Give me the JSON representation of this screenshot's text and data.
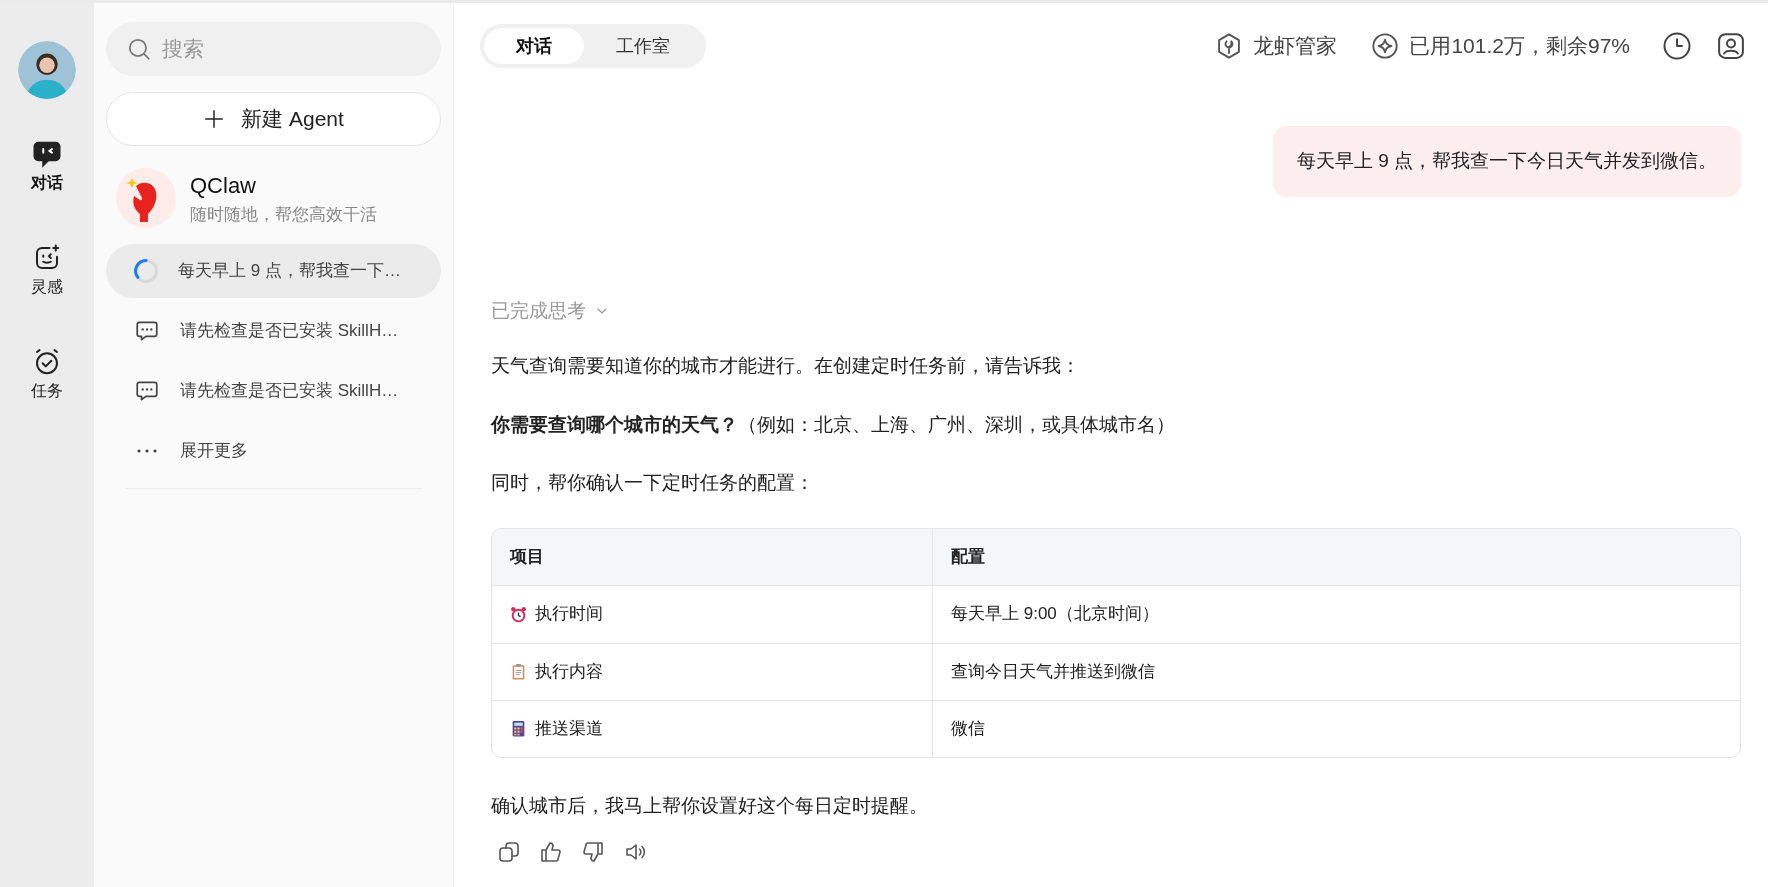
{
  "rail": {
    "nav": [
      {
        "label": "对话",
        "selected": true
      },
      {
        "label": "灵感",
        "selected": false
      },
      {
        "label": "任务",
        "selected": false
      }
    ]
  },
  "sidebar": {
    "search": {
      "placeholder": "搜索"
    },
    "new_button": "新建 Agent",
    "agent": {
      "name": "QClaw",
      "tagline": "随时随地，帮您高效干活"
    },
    "conversations": [
      {
        "kind": "running",
        "title": "每天早上 9 点，帮我查一下…",
        "selected": true
      },
      {
        "kind": "chat",
        "title": "请先检查是否已安装 SkillH…",
        "selected": false
      },
      {
        "kind": "chat",
        "title": "请先检查是否已安装 SkillH…",
        "selected": false
      }
    ],
    "more": "展开更多"
  },
  "header": {
    "tabs": [
      {
        "label": "对话",
        "selected": true
      },
      {
        "label": "工作室",
        "selected": false
      }
    ],
    "assistant": "龙虾管家",
    "usage": "已用101.2万，剩余97%"
  },
  "chat": {
    "user_message": "每天早上 9 点，帮我查一下今日天气并发到微信。",
    "thinking": "已完成思考",
    "paragraphs": [
      "天气查询需要知道你的城市才能进行。在创建定时任务前，请告诉我：",
      "**你需要查询哪个城市的天气？**（例如：北京、上海、广州、深圳，或具体城市名）",
      "同时，帮你确认一下定时任务的配置："
    ],
    "table": {
      "columns": [
        "项目",
        "配置"
      ],
      "rows": [
        [
          "执行时间",
          "每天早上 9:00（北京时间）"
        ],
        [
          "执行内容",
          "查询今日天气并推送到微信"
        ],
        [
          "推送渠道",
          "微信"
        ]
      ]
    },
    "closing": "确认城市后，我马上帮你设置好这个每日定时提醒。"
  }
}
